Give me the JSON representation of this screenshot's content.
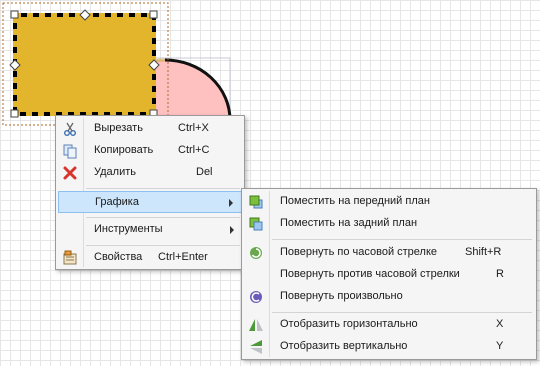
{
  "context_menu": {
    "items": [
      {
        "label": "Вырезать",
        "shortcut": "Ctrl+X",
        "icon": "scissors-icon"
      },
      {
        "label": "Копировать",
        "shortcut": "Ctrl+C",
        "icon": "copy-icon"
      },
      {
        "label": "Удалить",
        "shortcut": "Del",
        "icon": "delete-x-icon"
      },
      {
        "label": "Графика",
        "icon": ""
      },
      {
        "label": "Инструменты",
        "icon": ""
      },
      {
        "label": "Свойства",
        "shortcut": "Ctrl+Enter",
        "icon": "properties-icon"
      }
    ]
  },
  "graphics_submenu": {
    "items": [
      {
        "label": "Поместить на передний план",
        "shortcut": "",
        "icon": "bring-to-front-icon"
      },
      {
        "label": "Поместить на задний план",
        "shortcut": "",
        "icon": "send-to-back-icon"
      },
      {
        "label": "Повернуть по часовой стрелке",
        "shortcut": "Shift+R",
        "icon": "rotate-clockwise-icon"
      },
      {
        "label": "Повернуть против часовой стрелки",
        "shortcut": "R",
        "icon": "rotate-counterclockwise-icon"
      },
      {
        "label": "Повернуть произвольно",
        "shortcut": "",
        "icon": "rotate-free-icon"
      },
      {
        "label": "Отобразить горизонтально",
        "shortcut": "X",
        "icon": "flip-horizontal-icon"
      },
      {
        "label": "Отобразить вертикально",
        "shortcut": "Y",
        "icon": "flip-vertical-icon"
      }
    ]
  },
  "colors": {
    "rectangle_fill": "#e3b52d",
    "circle_fill": "#ffc0c0",
    "highlight": "#cde6fb",
    "selection_dash": "#b06a2a"
  }
}
